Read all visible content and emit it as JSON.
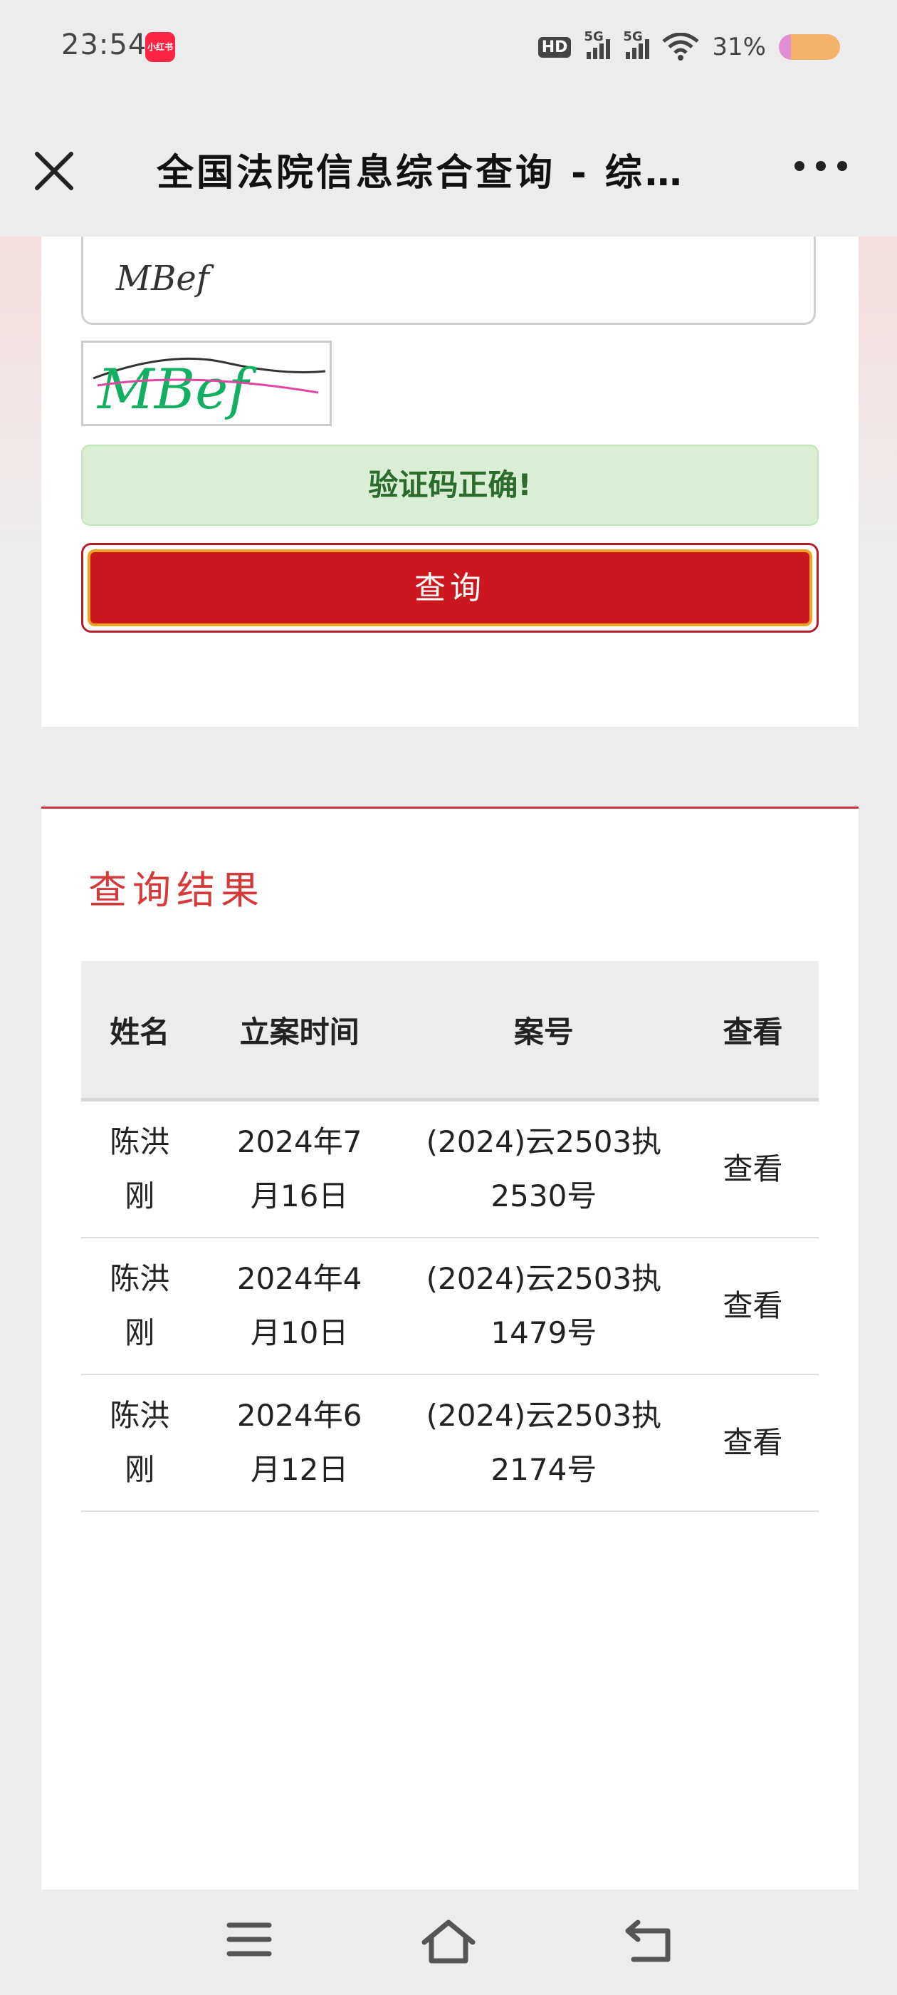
{
  "status_bar": {
    "time": "23:54",
    "app_badge": "小红书",
    "network_badge": "HD",
    "sim1": "5G",
    "sim2": "5G",
    "battery": "31%"
  },
  "nav": {
    "title": "全国法院信息综合查询 - 综…"
  },
  "form": {
    "captcha_value": "MBef",
    "captcha_image_text": "MBef",
    "captcha_status": "验证码正确!",
    "query_button": "查询"
  },
  "results": {
    "title": "查询结果",
    "headers": {
      "name": "姓名",
      "date": "立案时间",
      "case": "案号",
      "view": "查看"
    },
    "rows": [
      {
        "name": "陈洪刚",
        "date": "2024年7月16日",
        "case": "(2024)云2503执2530号",
        "view": "查看"
      },
      {
        "name": "陈洪刚",
        "date": "2024年4月10日",
        "case": "(2024)云2503执1479号",
        "view": "查看"
      },
      {
        "name": "陈洪刚",
        "date": "2024年6月12日",
        "case": "(2024)云2503执2174号",
        "view": "查看"
      }
    ]
  },
  "colors": {
    "accent_red": "#cc171f",
    "title_red": "#d53a3a",
    "success_bg": "#d8efd3",
    "link_blue": "#2a78b4"
  },
  "icons": {
    "close": "close-icon",
    "more": "more-icon",
    "menu": "menu-icon",
    "home": "home-icon",
    "back": "back-icon"
  }
}
